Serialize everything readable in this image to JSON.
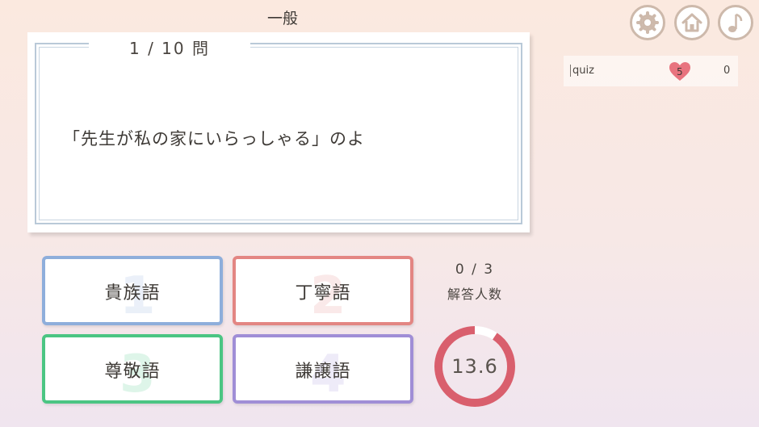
{
  "header": {
    "category": "一般"
  },
  "question": {
    "number": "1 / 10 問",
    "text": "「先生が私の家にいらっしゃる」のよ"
  },
  "toolbar": {
    "settings_icon": "gear-icon",
    "home_icon": "home-icon",
    "sound_icon": "music-note-icon"
  },
  "scoreboard": {
    "player": "quiz",
    "hearts": "5",
    "score": "0",
    "heart_color": "#e8737e"
  },
  "answers": [
    {
      "num": "1",
      "label": "貴族語",
      "color": "#8eaedb"
    },
    {
      "num": "2",
      "label": "丁寧語",
      "color": "#e38683"
    },
    {
      "num": "3",
      "label": "尊敬語",
      "color": "#4bc583"
    },
    {
      "num": "4",
      "label": "謙譲語",
      "color": "#a08ed6"
    }
  ],
  "status": {
    "answered": "0 / 3",
    "answered_label": "解答人数",
    "timer": "13.6",
    "timer_fraction": 0.907,
    "timer_color": "#d95f6d"
  }
}
